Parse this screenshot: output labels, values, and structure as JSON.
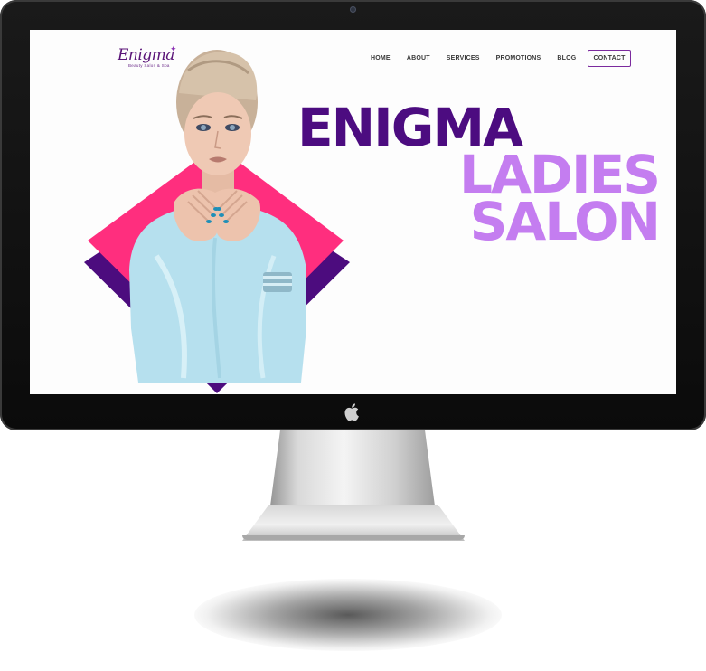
{
  "brand": {
    "logo_text": "Enigma",
    "tagline": "Beauty Salon & Spa",
    "accent_color": "#4c0c80",
    "light_accent_color": "#c47df0",
    "pink_color": "#ff2e7e"
  },
  "nav": {
    "items": [
      {
        "label": "HOME"
      },
      {
        "label": "ABOUT"
      },
      {
        "label": "SERVICES"
      },
      {
        "label": "PROMOTIONS"
      },
      {
        "label": "BLOG"
      },
      {
        "label": "CONTACT"
      }
    ]
  },
  "hero": {
    "line1": "ENIGMA",
    "line2": "LADIES",
    "line3": "SALON"
  },
  "device": {
    "brand_icon": "apple-icon"
  }
}
